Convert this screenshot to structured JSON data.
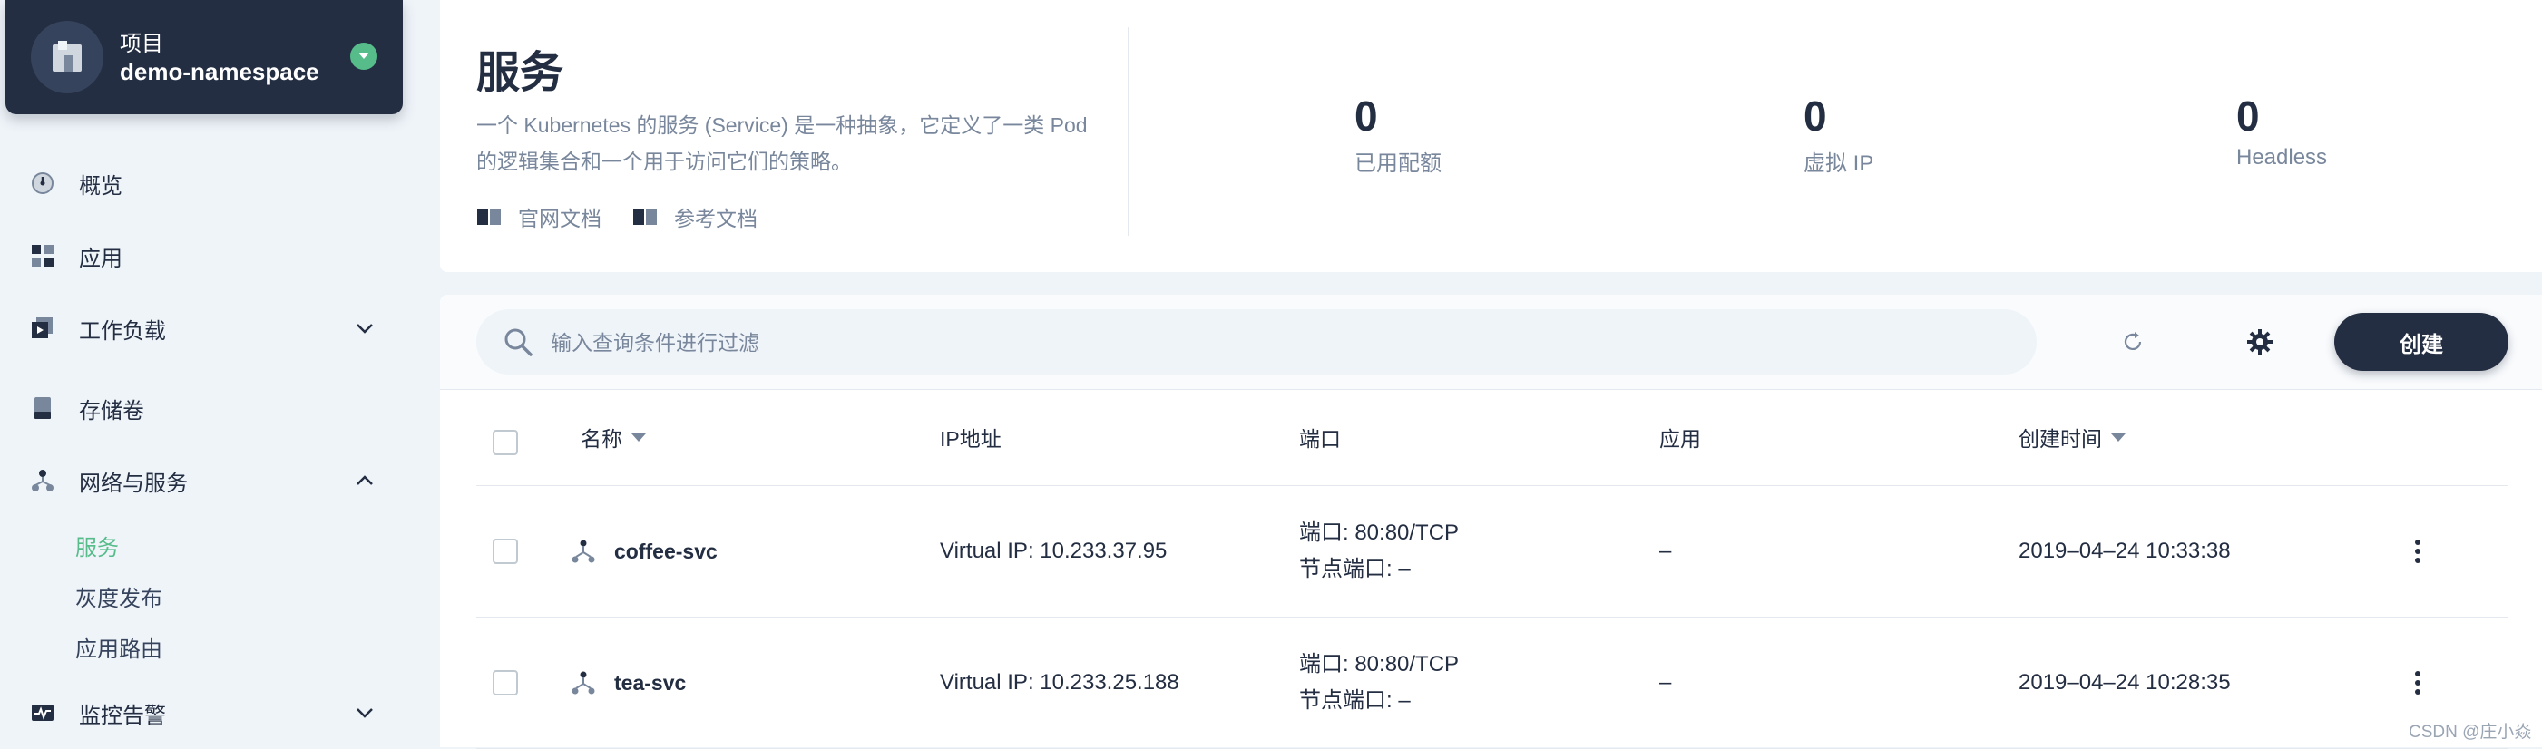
{
  "project": {
    "label": "项目",
    "name": "demo-namespace"
  },
  "nav": [
    {
      "label": "概览",
      "icon": "dashboard-icon"
    },
    {
      "label": "应用",
      "icon": "apps-icon"
    },
    {
      "label": "工作负载",
      "icon": "workload-icon",
      "expand": "collapsed"
    },
    {
      "label": "存储卷",
      "icon": "storage-icon"
    },
    {
      "label": "网络与服务",
      "icon": "network-icon",
      "expand": "expanded"
    },
    {
      "label": "监控告警",
      "icon": "monitor-icon",
      "expand": "collapsed"
    }
  ],
  "network_sub": [
    "服务",
    "灰度发布",
    "应用路由"
  ],
  "header": {
    "title": "服务",
    "description": "一个 Kubernetes 的服务 (Service) 是一种抽象，它定义了一类 Pod 的逻辑集合和一个用于访问它们的策略。",
    "links": [
      "官网文档",
      "参考文档"
    ]
  },
  "stats": [
    {
      "value": "0",
      "label": "已用配额"
    },
    {
      "value": "0",
      "label": "虚拟 IP"
    },
    {
      "value": "0",
      "label": "Headless"
    }
  ],
  "toolbar": {
    "search_placeholder": "输入查询条件进行过滤",
    "create_label": "创建"
  },
  "columns": [
    "名称",
    "IP地址",
    "端口",
    "应用",
    "创建时间"
  ],
  "rows": [
    {
      "name": "coffee-svc",
      "ip": "Virtual IP: 10.233.37.95",
      "port": "端口: 80:80/TCP",
      "node_port": "节点端口: –",
      "app": "–",
      "created": "2019–04–24 10:33:38"
    },
    {
      "name": "tea-svc",
      "ip": "Virtual IP: 10.233.25.188",
      "port": "端口: 80:80/TCP",
      "node_port": "节点端口: –",
      "app": "–",
      "created": "2019–04–24 10:28:35"
    }
  ],
  "watermark": "CSDN @庄小焱",
  "colors": {
    "dark": "#242e42",
    "accent": "#55bc8a",
    "muted": "#79879c",
    "bg": "#eff4f9"
  }
}
